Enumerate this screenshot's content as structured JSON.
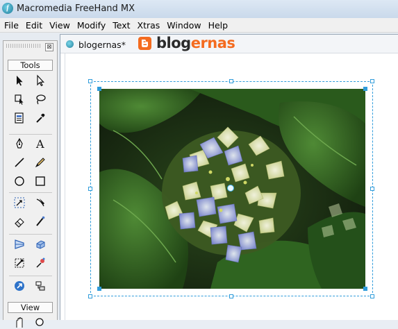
{
  "window": {
    "title": "Macromedia FreeHand MX"
  },
  "menu": [
    "File",
    "Edit",
    "View",
    "Modify",
    "Text",
    "Xtras",
    "Window",
    "Help"
  ],
  "panel": {
    "close_glyph": "⊠",
    "tools_label": "Tools",
    "view_label": "View",
    "tools": [
      "pointer-tool-icon",
      "subselect-tool-icon",
      "lasso-select-icon",
      "lasso-tool-icon",
      "page-tool-icon",
      "eyedropper-tool-icon",
      "pen-tool-icon",
      "text-tool-icon",
      "line-tool-icon",
      "pencil-tool-icon",
      "ellipse-tool-icon",
      "rectangle-tool-icon",
      "scale-tool-icon",
      "knife-tool-icon",
      "eraser-tool-icon",
      "freeform-tool-icon",
      "perspective-tool-icon",
      "extrude-tool-icon",
      "trace-tool-icon",
      "blend-tool-icon",
      "connector-tool-icon",
      "chart-tool-icon"
    ]
  },
  "document": {
    "tab_title": "blogernas*",
    "brand": {
      "prefix": "blog",
      "suffix": "ernas"
    }
  },
  "colors": {
    "selection": "#2f9cdb",
    "brand_accent": "#f46b1f"
  }
}
